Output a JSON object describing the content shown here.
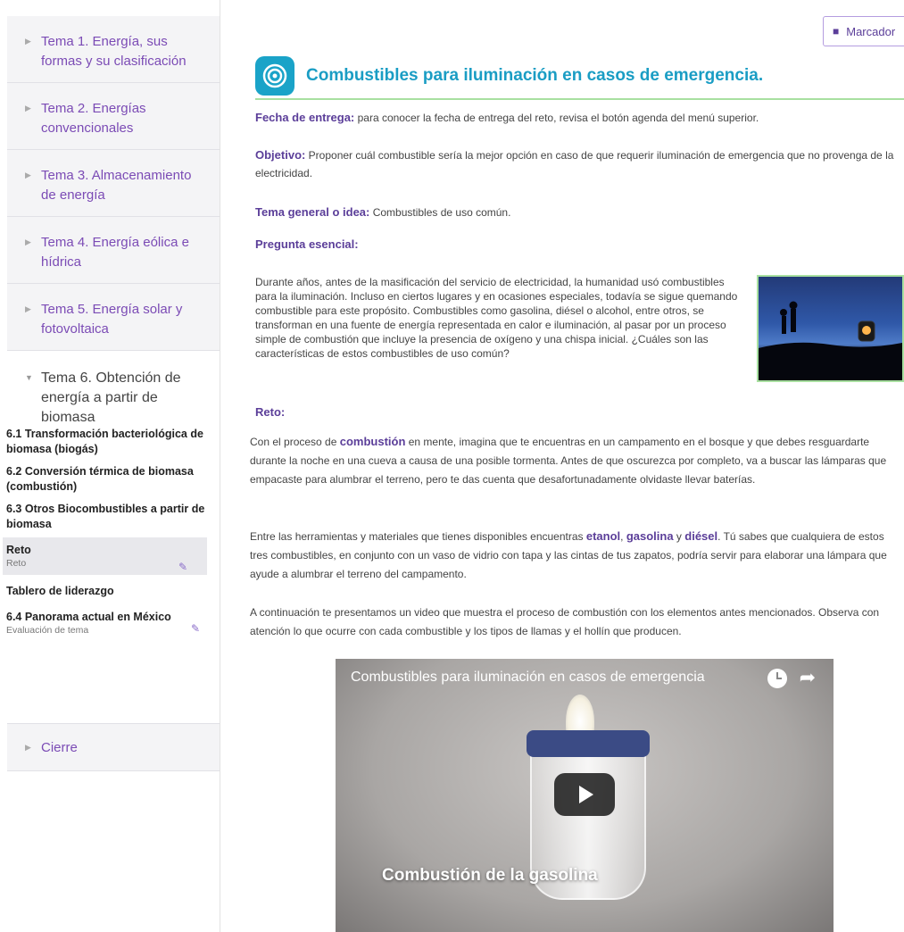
{
  "sidebar": {
    "topics": [
      {
        "label": "Tema 1. Energía, sus formas y su clasificación"
      },
      {
        "label": "Tema 2. Energías convencionales"
      },
      {
        "label": "Tema 3. Almacenamiento de energía"
      },
      {
        "label": "Tema 4. Energía eólica e hídrica"
      },
      {
        "label": "Tema 5. Energía solar y fotovoltaica"
      },
      {
        "label": "Tema 6. Obtención de energía a partir de biomasa"
      }
    ],
    "subitems": [
      {
        "title": "6.1 Transformación bacteriológica de biomasa (biogás)"
      },
      {
        "title": "6.2 Conversión térmica de biomasa (combustión)"
      },
      {
        "title": "6.3 Otros Biocombustibles a partir de biomasa"
      },
      {
        "title": "Reto",
        "subtitle": "Reto"
      },
      {
        "title": "Tablero de liderazgo"
      },
      {
        "title": "6.4 Panorama actual en México",
        "subtitle": "Evaluación de tema"
      }
    ],
    "cierre": "Cierre"
  },
  "header": {
    "bookmark_label": "Marcador",
    "title": "Combustibles para iluminación en casos de emergencia."
  },
  "content": {
    "fecha_label": "Fecha de entrega:",
    "fecha_text": " para conocer la fecha de entrega del reto, revisa el botón agenda del menú superior.",
    "objetivo_label": "Objetivo:",
    "objetivo_text": " Proponer cuál combustible sería la mejor opción en caso de que requerir iluminación de emergencia que no provenga de la electricidad.",
    "tema_label": "Tema general o idea:",
    "tema_text": " Combustibles de uso común.",
    "pregunta_label": "Pregunta esencial:",
    "pregunta_text": "Durante años, antes de la masificación del servicio de electricidad, la humanidad usó combustibles para la iluminación. Incluso en ciertos lugares y en ocasiones especiales, todavía se sigue quemando combustible para este propósito. Combustibles como gasolina, diésel o alcohol, entre otros, se transforman en una fuente de energía representada en calor e iluminación, al pasar por un proceso simple de combustión que incluye la presencia de oxígeno y una chispa inicial. ¿Cuáles son las características de estos combustibles de uso común?",
    "reto_label": "Reto:",
    "reto_p1_a": "Con el proceso de ",
    "reto_p1_kw": "combustión",
    "reto_p1_b": " en mente, imagina que te encuentras en un campamento en el bosque y que debes resguardarte durante la noche en una cueva a causa de una posible tormenta. Antes de que oscurezca por completo, va a buscar las lámparas que empacaste para alumbrar el terreno, pero te das cuenta que desafortunadamente olvidaste llevar baterías.",
    "reto_p2_a": "Entre las herramientas y materiales que tienes disponibles encuentras ",
    "reto_p2_kw1": "etanol",
    "reto_p2_sep1": ", ",
    "reto_p2_kw2": "gasolina",
    "reto_p2_sep2": " y ",
    "reto_p2_kw3": "diésel",
    "reto_p2_b": ". Tú sabes que cualquiera de estos tres combustibles, en conjunto con un vaso de vidrio con tapa y las cintas de tus zapatos, podría servir para elaborar una lámpara que ayude a alumbrar el terreno del campamento.",
    "reto_p3": "A continuación te presentamos un video que muestra el proceso de combustión con los elementos antes mencionados. Observa con atención lo que ocurre con cada combustible y los tipos de llamas y el hollín que producen."
  },
  "video": {
    "title": "Combustibles para iluminación en casos de emergencia",
    "caption": "Combustión de la gasolina"
  },
  "colors": {
    "accent_purple": "#5b3e99",
    "title_blue": "#1a9dc4",
    "divider_green": "#a8e0a0"
  }
}
